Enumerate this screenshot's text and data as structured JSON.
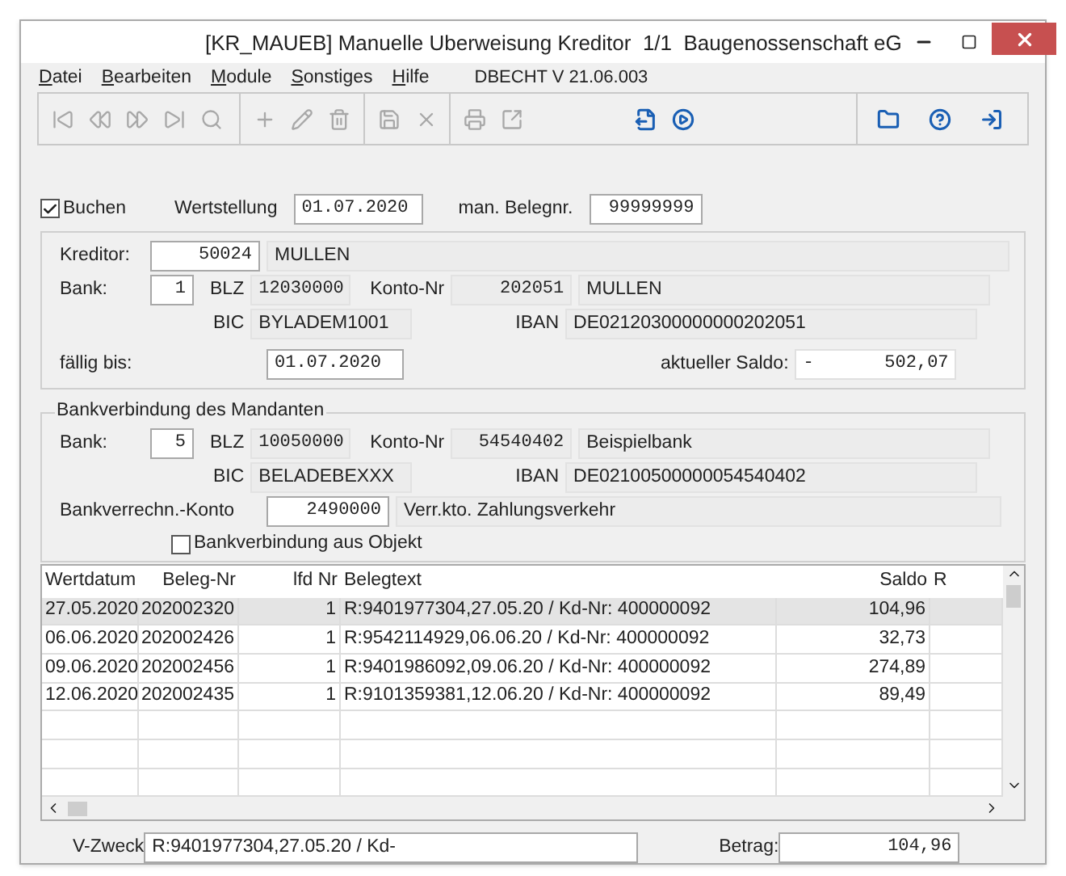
{
  "window": {
    "title": "[KR_MAUEB] Manuelle Uberweisung Kreditor  1/1  Baugenossenschaft eG"
  },
  "menu": [
    {
      "label": "Datei"
    },
    {
      "label": "Bearbeiten"
    },
    {
      "label": "Module"
    },
    {
      "label": "Sonstiges"
    },
    {
      "label": "Hilfe"
    }
  ],
  "version": "DBECHT V 21.06.003",
  "toolbar": [
    [
      {
        "kind": "first",
        "disabled": true
      },
      {
        "kind": "prev",
        "disabled": true
      },
      {
        "kind": "next",
        "disabled": true
      },
      {
        "kind": "last",
        "disabled": true
      },
      {
        "kind": "search",
        "disabled": true
      }
    ],
    [
      {
        "kind": "add",
        "disabled": true
      },
      {
        "kind": "edit",
        "disabled": true
      },
      {
        "kind": "delete",
        "disabled": true
      }
    ],
    [
      {
        "kind": "save",
        "disabled": true
      },
      {
        "kind": "cancel",
        "disabled": true
      }
    ],
    [
      {
        "kind": "print",
        "disabled": true
      },
      {
        "kind": "export",
        "disabled": true
      },
      {
        "kind": "file",
        "disabled": false
      },
      {
        "kind": "play",
        "disabled": false
      }
    ],
    [
      {
        "kind": "folder",
        "disabled": false
      },
      {
        "kind": "help",
        "disabled": false
      },
      {
        "kind": "exit",
        "disabled": false
      }
    ]
  ],
  "header": {
    "buchen": {
      "label": "Buchen",
      "checked": true
    },
    "wertstellung": {
      "label": "Wertstellung",
      "value": "01.07.2020"
    },
    "belegnr": {
      "label": "man. Belegnr.",
      "value": "99999999"
    }
  },
  "kreditor": {
    "label": "Kreditor:",
    "number": "50024",
    "name": "MULLEN",
    "bank_label": "Bank:",
    "bank": "1",
    "blz_label": "BLZ",
    "blz": "12030000",
    "konto_label": "Konto-Nr",
    "konto": "202051",
    "bank_name": "MULLEN",
    "bic_label": "BIC",
    "bic": "BYLADEM1001",
    "iban_label": "IBAN",
    "iban": "DE02120300000000202051",
    "faellig_label": "fällig bis:",
    "faellig": "01.07.2020",
    "saldo_label": "aktueller Saldo:",
    "saldo_sign": "-",
    "saldo": "502,07"
  },
  "mandant": {
    "title": "Bankverbindung des Mandanten",
    "bank_label": "Bank:",
    "bank": "5",
    "blz_label": "BLZ",
    "blz": "10050000",
    "konto_label": "Konto-Nr",
    "konto": "54540402",
    "bank_name": "Beispielbank",
    "bic_label": "BIC",
    "bic": "BELADEBEXXX",
    "iban_label": "IBAN",
    "iban": "DE02100500000054540402",
    "verrechnung_label": "Bankverrechn.-Konto",
    "verrechnung": "2490000",
    "verrechnung_name": "Verr.kto. Zahlungsverkehr",
    "objekt": {
      "label": "Bankverbindung aus Objekt",
      "checked": false
    }
  },
  "table": {
    "columns": [
      "Wertdatum",
      "Beleg-Nr",
      "lfd Nr",
      "Belegtext",
      "Saldo",
      "R"
    ],
    "rows": [
      {
        "cells": [
          "27.05.2020",
          "202002320",
          "1",
          "R:9401977304,27.05.20 / Kd-Nr: 400000092",
          "104,96",
          ""
        ],
        "selected": true
      },
      {
        "cells": [
          "06.06.2020",
          "202002426",
          "1",
          "R:9542114929,06.06.20 / Kd-Nr: 400000092",
          "32,73",
          ""
        ],
        "selected": false
      },
      {
        "cells": [
          "09.06.2020",
          "202002456",
          "1",
          "R:9401986092,09.06.20 / Kd-Nr: 400000092",
          "274,89",
          ""
        ],
        "selected": false
      },
      {
        "cells": [
          "12.06.2020",
          "202002435",
          "1",
          "R:9101359381,12.06.20 / Kd-Nr: 400000092",
          "89,49",
          ""
        ],
        "selected": false
      }
    ]
  },
  "footer": {
    "zweck_label": "V-Zweck",
    "zweck": "R:9401977304,27.05.20 / Kd-",
    "betrag_label": "Betrag:",
    "betrag": "104,96"
  }
}
